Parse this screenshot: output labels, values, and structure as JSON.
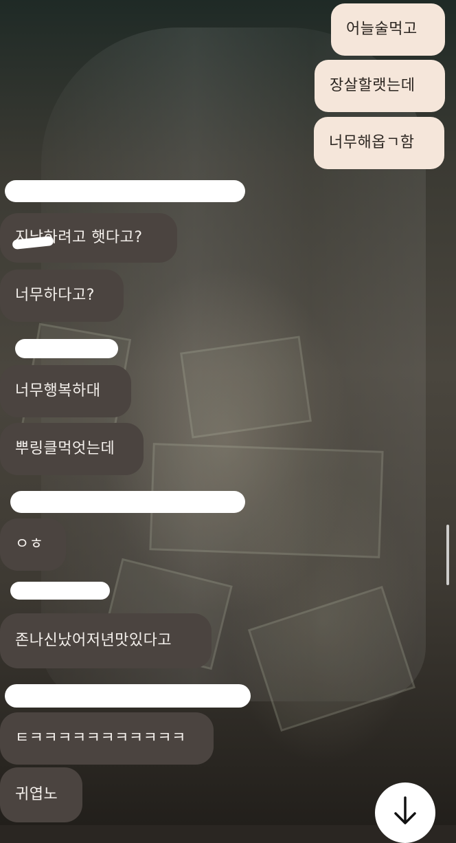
{
  "sent_messages": [
    "어늘술먹고",
    "장살할랫는데",
    "너무해옵ㄱ함"
  ],
  "received_messages": [
    "지낭하려고 햇다고?",
    "너무하다고?",
    "너무행복하대",
    "뿌링클먹엇는데",
    "ㅇㅎ",
    "존나신났어저년맛있다고",
    "ㅌㅋㅋㅋㅋㅋㅋㅋㅋㅋㅋㅋ",
    "귀엽노"
  ],
  "icons": {
    "scroll_down": "arrow-down-icon"
  }
}
